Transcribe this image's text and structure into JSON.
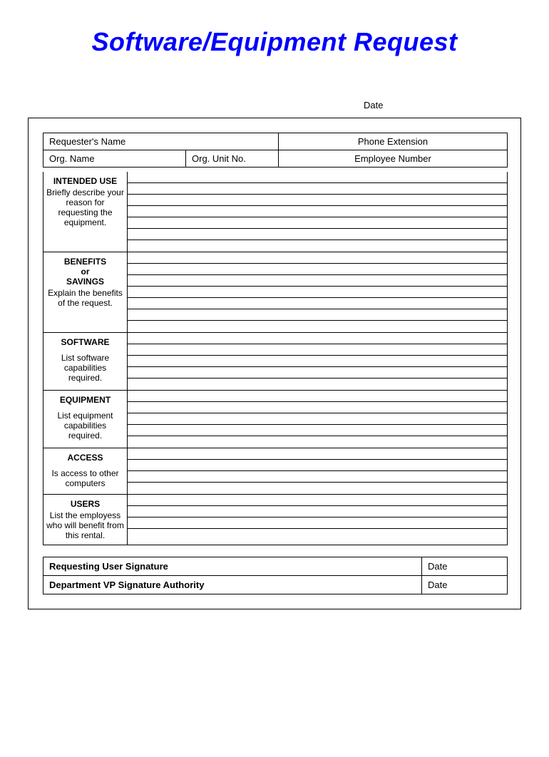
{
  "title": "Software/Equipment Request",
  "dateLabel": "Date",
  "info": {
    "requesterName": "Requester's Name",
    "phoneExt": "Phone Extension",
    "orgName": "Org. Name",
    "orgUnit": "Org. Unit No.",
    "empNum": "Employee Number"
  },
  "sections": {
    "intended": {
      "title": "INTENDED USE",
      "desc": "Briefly describe your reason for requesting the equipment."
    },
    "benefits": {
      "title1": "BENEFITS",
      "or": "or",
      "title2": "SAVINGS",
      "desc": "Explain the benefits of the request."
    },
    "software": {
      "title": "SOFTWARE",
      "desc": "List software capabilities required."
    },
    "equipment": {
      "title": "EQUIPMENT",
      "desc": "List equipment capabilities required."
    },
    "access": {
      "title": "ACCESS",
      "desc": "Is access to other computers"
    },
    "users": {
      "title": "USERS",
      "desc": "List the employess who will benefit from this rental."
    }
  },
  "sig": {
    "user": "Requesting User Signature",
    "vp": "Department VP Signature Authority",
    "date1": "Date",
    "date2": "Date"
  }
}
